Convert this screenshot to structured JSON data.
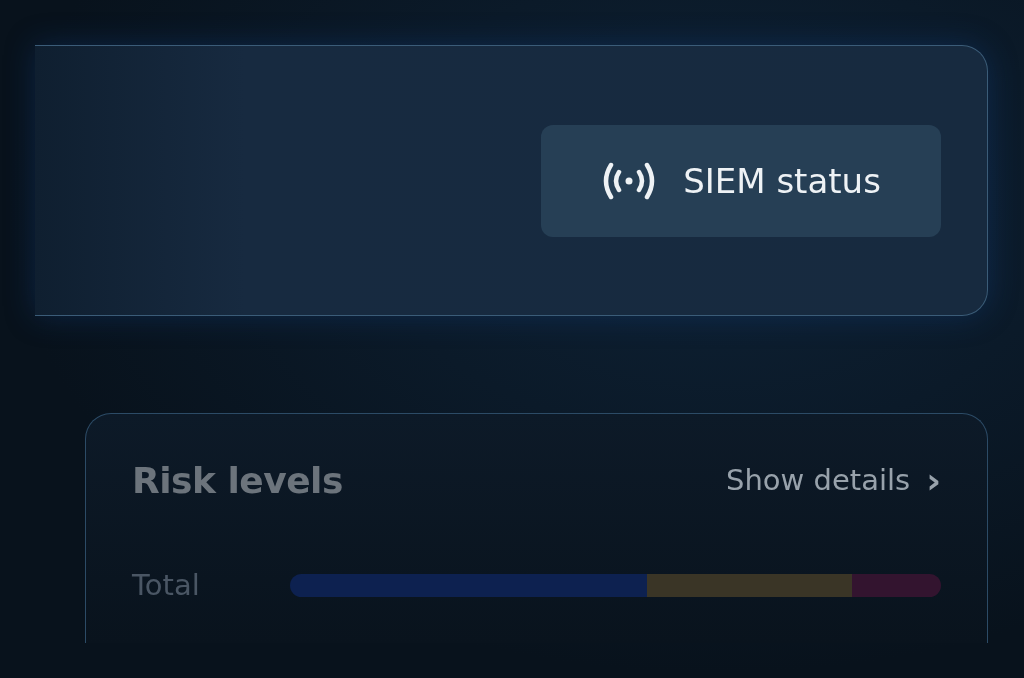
{
  "status_button": {
    "label": "SIEM status"
  },
  "risk_levels": {
    "title": "Risk levels",
    "link": "Show details",
    "link_icon": "›",
    "rows": [
      {
        "label": "Total",
        "segments": [
          {
            "color": "#0d2150"
          },
          {
            "color": "#3a3526"
          },
          {
            "color": "#33142f"
          }
        ]
      }
    ]
  }
}
